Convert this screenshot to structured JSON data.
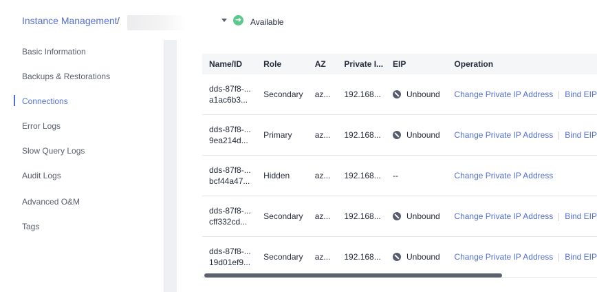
{
  "breadcrumb": {
    "root": "Instance Management",
    "separator": "/"
  },
  "status": {
    "icon": "arrow-right-circle-icon",
    "label": "Available",
    "color": "#5dc88d"
  },
  "sidebar": {
    "items": [
      {
        "label": "Basic Information"
      },
      {
        "label": "Backups & Restorations"
      },
      {
        "label": "Connections",
        "active": true
      },
      {
        "label": "Error Logs"
      },
      {
        "label": "Slow Query Logs"
      },
      {
        "label": "Audit Logs"
      },
      {
        "label": "Advanced O&M"
      },
      {
        "label": "Tags"
      }
    ]
  },
  "table": {
    "columns": [
      "Name/ID",
      "Role",
      "AZ",
      "Private I...",
      "EIP",
      "Operation"
    ],
    "rows": [
      {
        "name1": "dds-87f8-...",
        "name2": "a1ac6b3...",
        "role": "Secondary",
        "az": "az...",
        "ip": "192.168...",
        "eip": "Unbound",
        "op1": "Change Private IP Address",
        "op2": "Bind EIP"
      },
      {
        "name1": "dds-87f8-...",
        "name2": "9ea214d...",
        "role": "Primary",
        "az": "az...",
        "ip": "192.168...",
        "eip": "Unbound",
        "op1": "Change Private IP Address",
        "op2": "Bind EIP"
      },
      {
        "name1": "dds-87f8-...",
        "name2": "bcf44a47...",
        "role": "Hidden",
        "az": "az...",
        "ip": "192.168...",
        "eip": "--",
        "op1": "Change Private IP Address",
        "op2": ""
      },
      {
        "name1": "dds-87f8-...",
        "name2": "cff332cd...",
        "role": "Secondary",
        "az": "az...",
        "ip": "192.168...",
        "eip": "Unbound",
        "op1": "Change Private IP Address",
        "op2": "Bind EIP"
      },
      {
        "name1": "dds-87f8-...",
        "name2": "19d01ef9...",
        "role": "Secondary",
        "az": "az...",
        "ip": "192.168...",
        "eip": "Unbound",
        "op1": "Change Private IP Address",
        "op2": "Bind EIP"
      }
    ]
  },
  "colors": {
    "accent": "#526ecc",
    "scrollbar": "#5c6270"
  }
}
